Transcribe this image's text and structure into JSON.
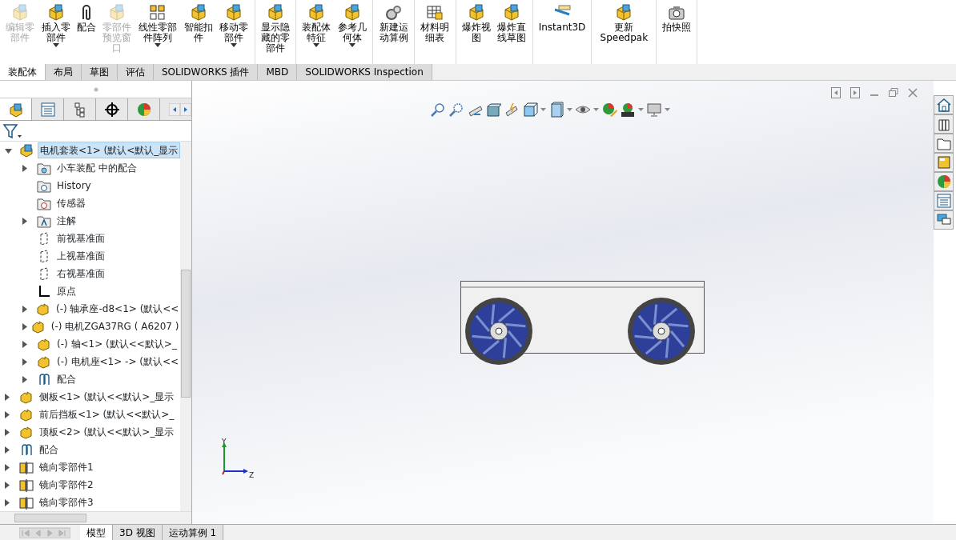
{
  "ribbon": {
    "groups": [
      [
        {
          "label": "编辑零部件",
          "disabled": true
        },
        {
          "label": "插入零部件",
          "dropdown": true
        },
        {
          "label": "配合"
        },
        {
          "label": "零部件预览窗口",
          "disabled": true
        },
        {
          "label": "线性零部件阵列",
          "dropdown": true
        },
        {
          "label": "智能扣件"
        },
        {
          "label": "移动零部件",
          "dropdown": true
        }
      ],
      [
        {
          "label": "显示隐藏的零部件"
        }
      ],
      [
        {
          "label": "装配体特征",
          "dropdown": true
        },
        {
          "label": "参考几何体",
          "dropdown": true
        }
      ],
      [
        {
          "label": "新建运动算例"
        }
      ],
      [
        {
          "label": "材料明细表"
        }
      ],
      [
        {
          "label": "爆炸视图"
        },
        {
          "label": "爆炸直线草图"
        }
      ],
      [
        {
          "label": "Instant3D"
        }
      ],
      [
        {
          "label": "更新Speedpak"
        }
      ],
      [
        {
          "label": "拍快照"
        }
      ]
    ]
  },
  "tabs": [
    {
      "label": "装配体",
      "selected": true
    },
    {
      "label": "布局",
      "selected": false
    },
    {
      "label": "草图",
      "selected": false
    },
    {
      "label": "评估",
      "selected": false
    },
    {
      "label": "SOLIDWORKS 插件",
      "selected": false
    },
    {
      "label": "MBD",
      "selected": false
    },
    {
      "label": "SOLIDWORKS Inspection",
      "selected": false
    }
  ],
  "tree": [
    {
      "label": "电机套装<1> (默认<默认_显示",
      "kind": "assembly",
      "expanded": true,
      "selected": true,
      "children": [
        {
          "label": "小车装配 中的配合",
          "kind": "mate-folder",
          "expanded": false,
          "selected": false
        },
        {
          "label": "History",
          "kind": "history",
          "selected": false
        },
        {
          "label": "传感器",
          "kind": "sensor",
          "selected": false
        },
        {
          "label": "注解",
          "kind": "annotation",
          "expanded": false,
          "selected": false
        },
        {
          "label": "前视基准面",
          "kind": "plane",
          "selected": false
        },
        {
          "label": "上视基准面",
          "kind": "plane",
          "selected": false
        },
        {
          "label": "右视基准面",
          "kind": "plane",
          "selected": false
        },
        {
          "label": "原点",
          "kind": "origin",
          "selected": false
        },
        {
          "label": "(-) 轴承座-d8<1> (默认<<",
          "kind": "part",
          "expanded": false,
          "selected": false
        },
        {
          "label": "(-) 电机ZGA37RG ( A6207 )",
          "kind": "part",
          "expanded": false,
          "selected": false
        },
        {
          "label": "(-) 轴<1> (默认<<默认>_",
          "kind": "part",
          "expanded": false,
          "selected": false
        },
        {
          "label": "(-) 电机座<1> -> (默认<<",
          "kind": "part",
          "expanded": false,
          "selected": false
        },
        {
          "label": "配合",
          "kind": "mate",
          "expanded": false,
          "selected": false
        }
      ]
    },
    {
      "label": "侧板<1> (默认<<默认>_显示",
      "kind": "part",
      "expanded": false,
      "selected": false
    },
    {
      "label": "前后挡板<1> (默认<<默认>_",
      "kind": "part",
      "expanded": false,
      "selected": false
    },
    {
      "label": "顶板<2> (默认<<默认>_显示",
      "kind": "part",
      "expanded": false,
      "selected": false
    },
    {
      "label": "配合",
      "kind": "mate",
      "expanded": false,
      "selected": false
    },
    {
      "label": "镜向零部件1",
      "kind": "mirror",
      "expanded": false,
      "selected": false
    },
    {
      "label": "镜向零部件2",
      "kind": "mirror",
      "expanded": false,
      "selected": false
    },
    {
      "label": "镜向零部件3",
      "kind": "mirror",
      "expanded": false,
      "selected": false
    }
  ],
  "triad": {
    "y_label": "Y",
    "z_label": "Z"
  },
  "bottom_tabs": [
    {
      "label": "模型",
      "selected": true
    },
    {
      "label": "3D 视图",
      "selected": false
    },
    {
      "label": "运动算例 1",
      "selected": false
    }
  ]
}
